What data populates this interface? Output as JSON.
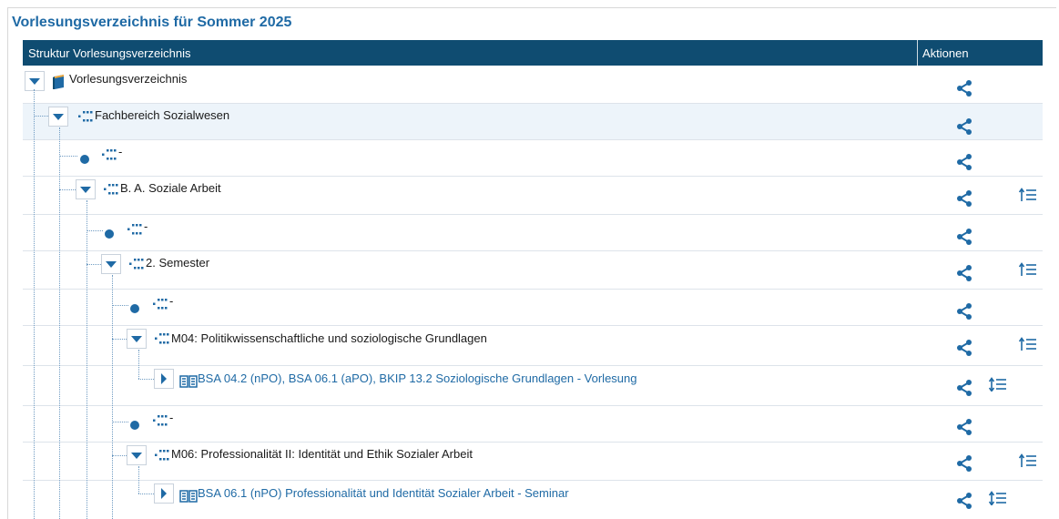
{
  "page": {
    "title": "Vorlesungsverzeichnis für Sommer 2025"
  },
  "table": {
    "col_structure": "Struktur Vorlesungsverzeichnis",
    "col_actions": "Aktionen"
  },
  "rows": [
    {
      "label": "Vorlesungsverzeichnis"
    },
    {
      "label": "Fachbereich Sozialwesen"
    },
    {
      "label": "-"
    },
    {
      "label": "B. A. Soziale Arbeit"
    },
    {
      "label": "-"
    },
    {
      "label": "2. Semester"
    },
    {
      "label": "-"
    },
    {
      "label": "M04: Politikwissenschaftliche und soziologische Grundlagen"
    },
    {
      "label": "BSA 04.2 (nPO), BSA 06.1 (aPO), BKIP 13.2 Soziologische Grundlagen - Vorlesung"
    },
    {
      "label": "-"
    },
    {
      "label": "M06: Professionalität II: Identität und Ethik Sozialer Arbeit"
    },
    {
      "label": "BSA 06.1 (nPO) Professionalität und Identität Sozialer Arbeit - Seminar"
    }
  ],
  "icons": {
    "share": "share-icon",
    "sort": "sort-icon",
    "expand": "chevron-down-icon",
    "collapse": "chevron-right-icon",
    "book": "book-icon",
    "structure": "structure-icon"
  },
  "colors": {
    "accent": "#1f6aa5",
    "header_bg": "#0f4c71",
    "highlight_row": "#edf4fa"
  }
}
